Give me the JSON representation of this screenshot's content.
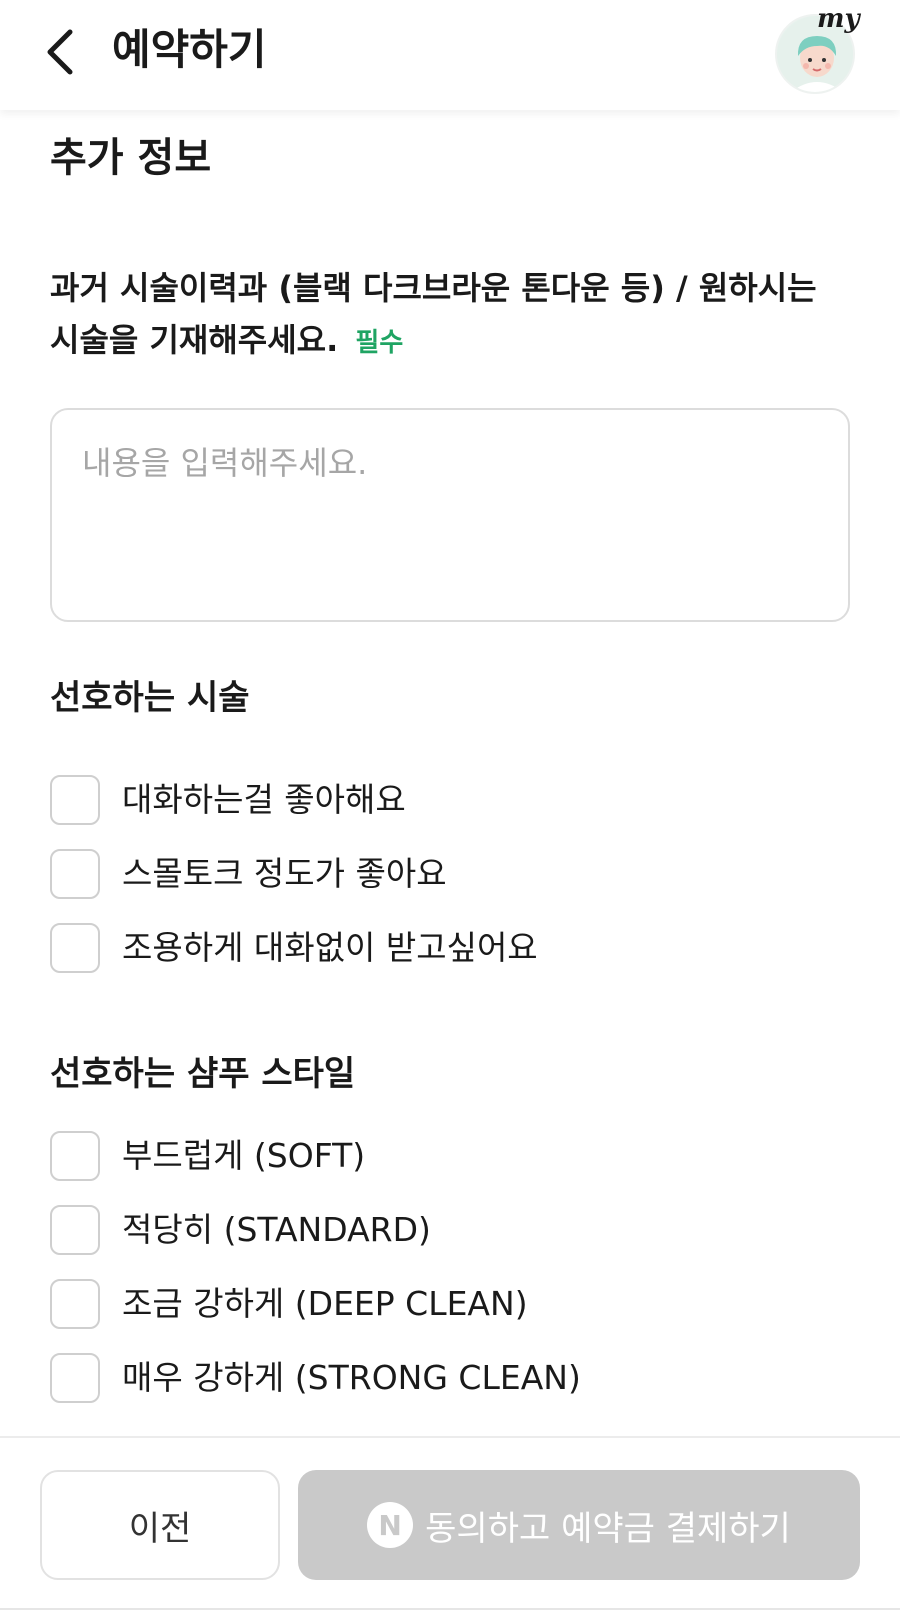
{
  "header": {
    "title": "예약하기",
    "my_label": "my"
  },
  "section": {
    "title": "추가 정보"
  },
  "history_question": {
    "text": "과거 시술이력과 (블랙 다크브라운 톤다운 등) / 원하시는 시술을 기재해주세요.",
    "required_badge": "필수",
    "placeholder": "내용을 입력해주세요.",
    "value": ""
  },
  "preferred_service": {
    "title": "선호하는 시술",
    "options": [
      {
        "label": "대화하는걸 좋아해요",
        "checked": false
      },
      {
        "label": "스몰토크 정도가 좋아요",
        "checked": false
      },
      {
        "label": "조용하게 대화없이 받고싶어요",
        "checked": false
      }
    ]
  },
  "shampoo_style": {
    "title": "선호하는 샴푸 스타일",
    "options": [
      {
        "label": "부드럽게 (SOFT)",
        "checked": false
      },
      {
        "label": "적당히 (STANDARD)",
        "checked": false
      },
      {
        "label": "조금 강하게 (DEEP CLEAN)",
        "checked": false
      },
      {
        "label": "매우 강하게 (STRONG CLEAN)",
        "checked": false
      }
    ]
  },
  "footer": {
    "prev_label": "이전",
    "pay_icon": "N",
    "pay_label": "동의하고 예약금 결제하기"
  },
  "colors": {
    "accent_green": "#1fa463",
    "disabled_button": "#c9c9c9"
  }
}
